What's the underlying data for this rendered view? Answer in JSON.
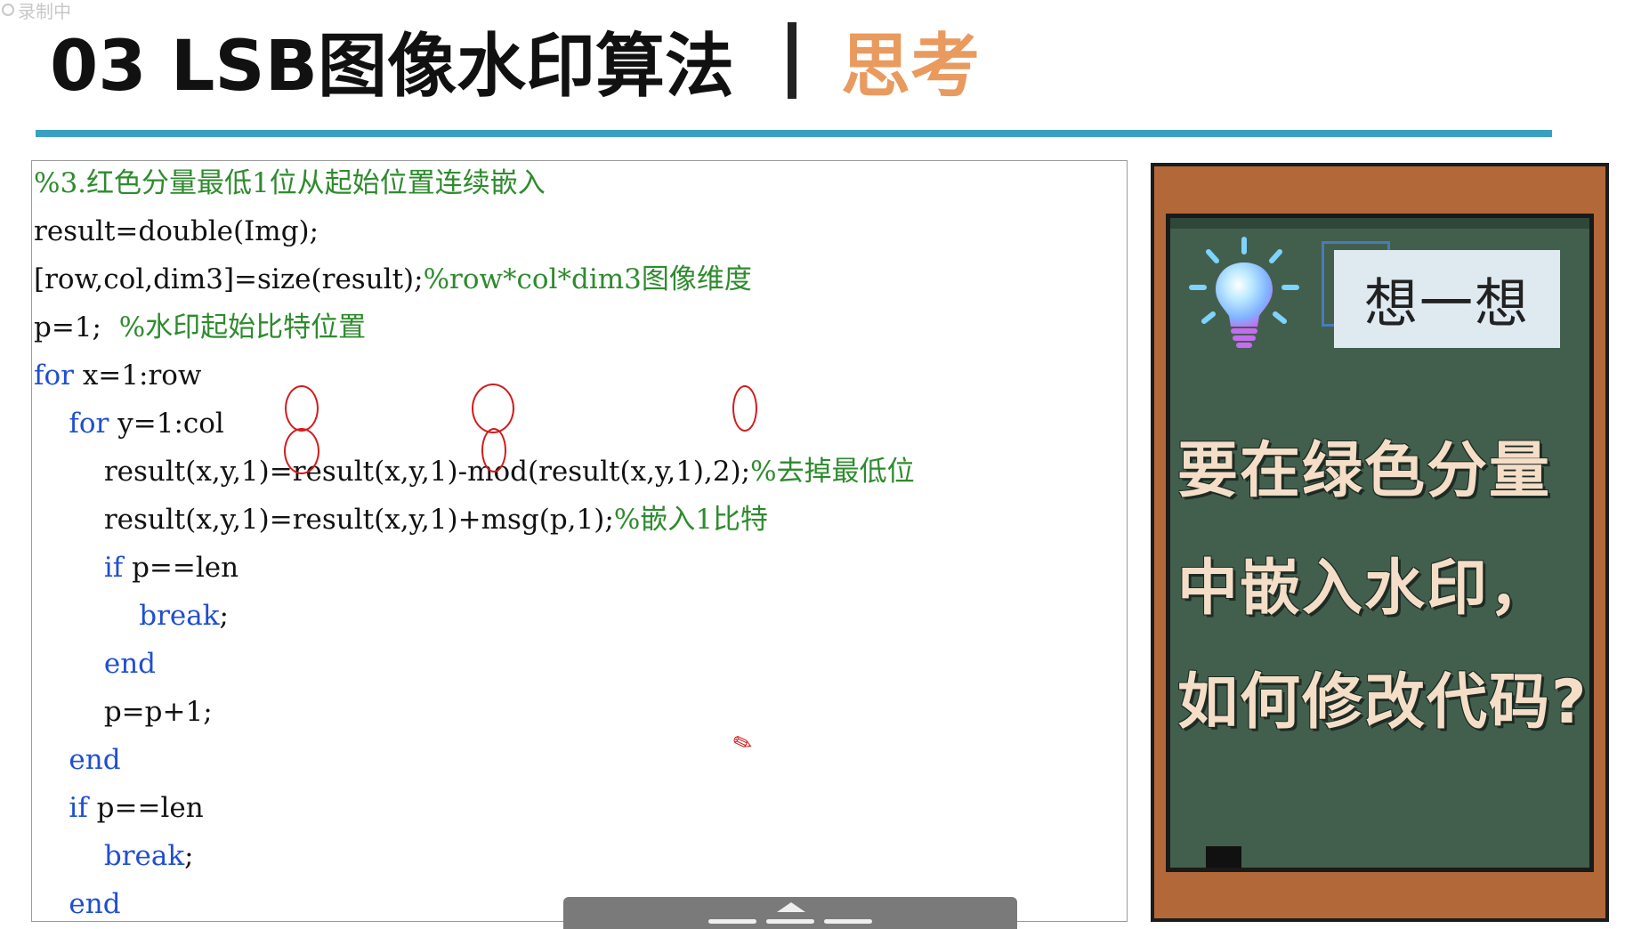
{
  "recording_badge": {
    "label": "录制中"
  },
  "header": {
    "title": "03  LSB图像水印算法",
    "subtitle": "思考",
    "rule_color": "#3aa0c2",
    "subtitle_color": "#e99a5f"
  },
  "code": {
    "lines": [
      {
        "segments": [
          {
            "text": "%3.红色分量最低1位从起始位置连续嵌入",
            "kind": "comment"
          }
        ]
      },
      {
        "segments": [
          {
            "text": "result=double(Img);",
            "kind": "code"
          }
        ]
      },
      {
        "segments": [
          {
            "text": "[row,col,dim3]=size(result);",
            "kind": "code"
          },
          {
            "text": "%row*col*dim3图像维度",
            "kind": "comment"
          }
        ]
      },
      {
        "segments": [
          {
            "text": "p=1;  ",
            "kind": "code"
          },
          {
            "text": "%水印起始比特位置",
            "kind": "comment"
          }
        ]
      },
      {
        "segments": [
          {
            "text": "for",
            "kind": "keyword"
          },
          {
            "text": " x=1:row",
            "kind": "code"
          }
        ]
      },
      {
        "segments": [
          {
            "text": "    ",
            "kind": "code"
          },
          {
            "text": "for",
            "kind": "keyword"
          },
          {
            "text": " y=1:col",
            "kind": "code"
          }
        ]
      },
      {
        "segments": [
          {
            "text": "        result(x,y,1)=result(x,y,1)-mod(result(x,y,1),2);",
            "kind": "code"
          },
          {
            "text": "%去掉最低位",
            "kind": "comment"
          }
        ]
      },
      {
        "segments": [
          {
            "text": "        result(x,y,1)=result(x,y,1)+msg(p,1);",
            "kind": "code"
          },
          {
            "text": "%嵌入1比特",
            "kind": "comment"
          }
        ]
      },
      {
        "segments": [
          {
            "text": "        ",
            "kind": "code"
          },
          {
            "text": "if",
            "kind": "keyword"
          },
          {
            "text": " p==len",
            "kind": "code"
          }
        ]
      },
      {
        "segments": [
          {
            "text": "            ",
            "kind": "code"
          },
          {
            "text": "break",
            "kind": "keyword"
          },
          {
            "text": ";",
            "kind": "code"
          }
        ]
      },
      {
        "segments": [
          {
            "text": "        ",
            "kind": "code"
          },
          {
            "text": "end",
            "kind": "keyword"
          }
        ]
      },
      {
        "segments": [
          {
            "text": "        p=p+1;",
            "kind": "code"
          }
        ]
      },
      {
        "segments": [
          {
            "text": "    ",
            "kind": "code"
          },
          {
            "text": "end",
            "kind": "keyword"
          }
        ]
      },
      {
        "segments": [
          {
            "text": "    ",
            "kind": "code"
          },
          {
            "text": "if",
            "kind": "keyword"
          },
          {
            "text": " p==len",
            "kind": "code"
          }
        ]
      },
      {
        "segments": [
          {
            "text": "        ",
            "kind": "code"
          },
          {
            "text": "break",
            "kind": "keyword"
          },
          {
            "text": ";",
            "kind": "code"
          }
        ]
      },
      {
        "segments": [
          {
            "text": "    ",
            "kind": "code"
          },
          {
            "text": "end",
            "kind": "keyword"
          }
        ]
      }
    ],
    "colors": {
      "comment": "#2e8b2e",
      "keyword": "#1f4fd0",
      "code": "#111111",
      "pen": "#d21c1c"
    }
  },
  "blackboard": {
    "card_label": "想一想",
    "question_lines": [
      "要在绿色分量",
      "中嵌入水印，",
      "如何修改代码?"
    ],
    "chalk_color": "#f4dec7",
    "board_color": "#425f4e",
    "frame_color": "#b3683a",
    "icon": "lightbulb-icon"
  },
  "playback": {
    "icon": "chevron-up-icon"
  }
}
